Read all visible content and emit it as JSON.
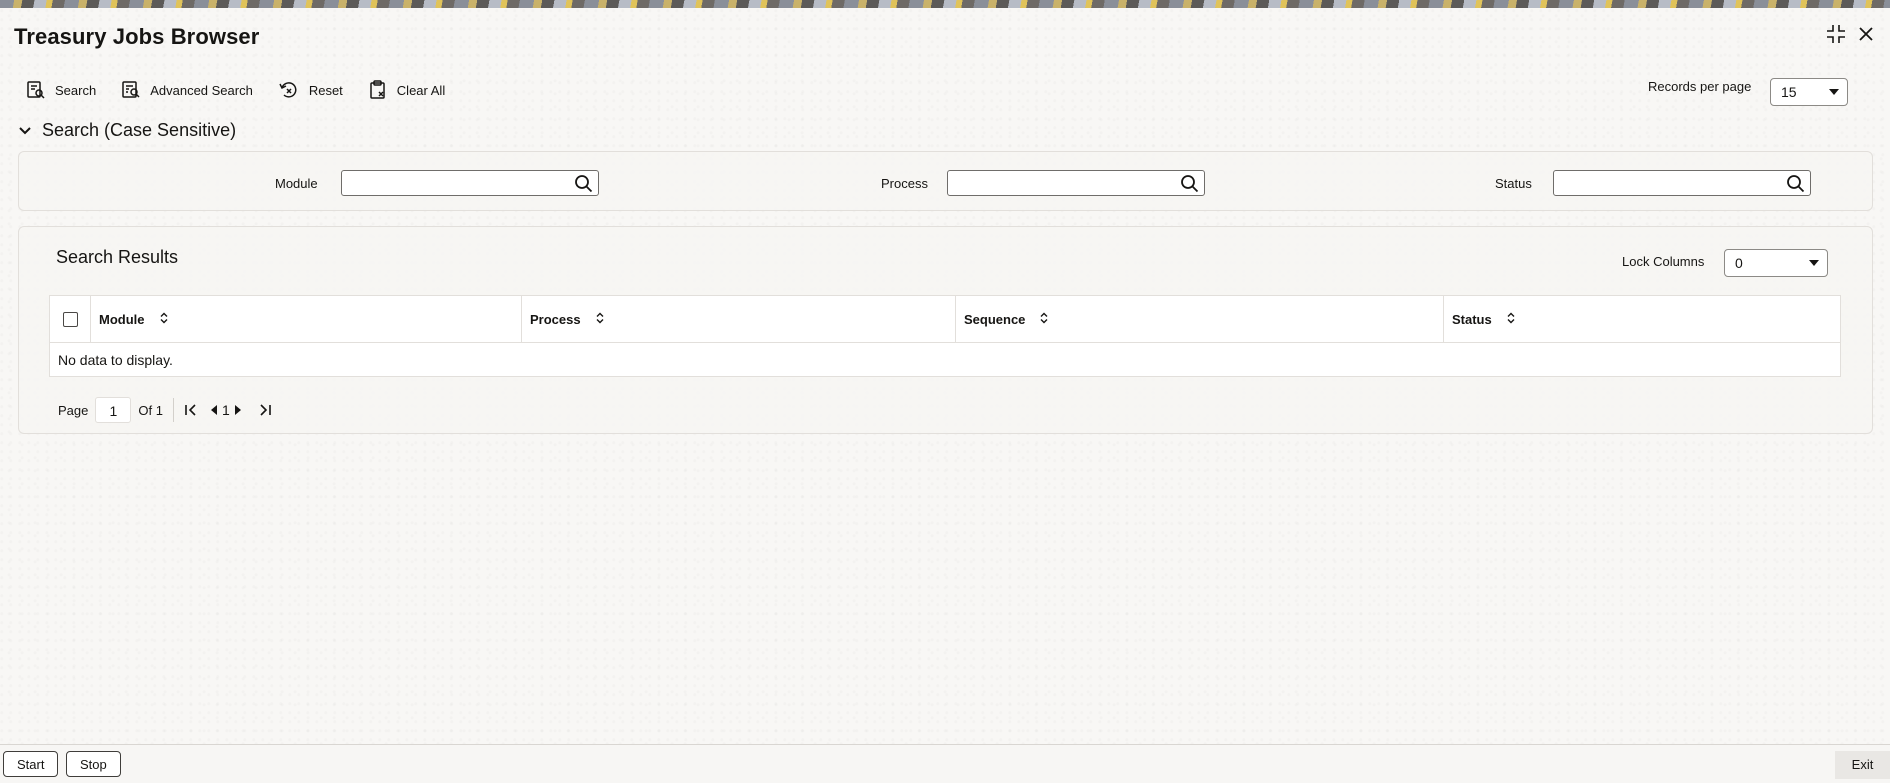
{
  "window": {
    "title": "Treasury Jobs Browser"
  },
  "toolbar": {
    "search_label": "Search",
    "advanced_search_label": "Advanced Search",
    "reset_label": "Reset",
    "clear_all_label": "Clear All",
    "records_per_page_label": "Records per page",
    "records_per_page_value": "15"
  },
  "search_section": {
    "title": "Search (Case Sensitive)",
    "fields": [
      {
        "label": "Module",
        "value": ""
      },
      {
        "label": "Process",
        "value": ""
      },
      {
        "label": "Status",
        "value": ""
      }
    ]
  },
  "results": {
    "title": "Search Results",
    "lock_columns_label": "Lock Columns",
    "lock_columns_value": "0",
    "columns": [
      "Module",
      "Process",
      "Sequence",
      "Status"
    ],
    "empty_message": "No data to display.",
    "pager": {
      "page_label": "Page",
      "current_page": "1",
      "of_label": "Of 1",
      "nav_page": "1"
    }
  },
  "footer": {
    "start_label": "Start",
    "stop_label": "Stop",
    "exit_label": "Exit"
  },
  "icons": [
    "maximize-icon",
    "close-icon",
    "search-doc-icon",
    "advanced-search-icon",
    "reset-icon",
    "clear-all-icon",
    "chevron-down-icon",
    "magnifier-icon",
    "sort-icon",
    "first-page-icon",
    "prev-page-icon",
    "next-page-icon",
    "last-page-icon"
  ]
}
